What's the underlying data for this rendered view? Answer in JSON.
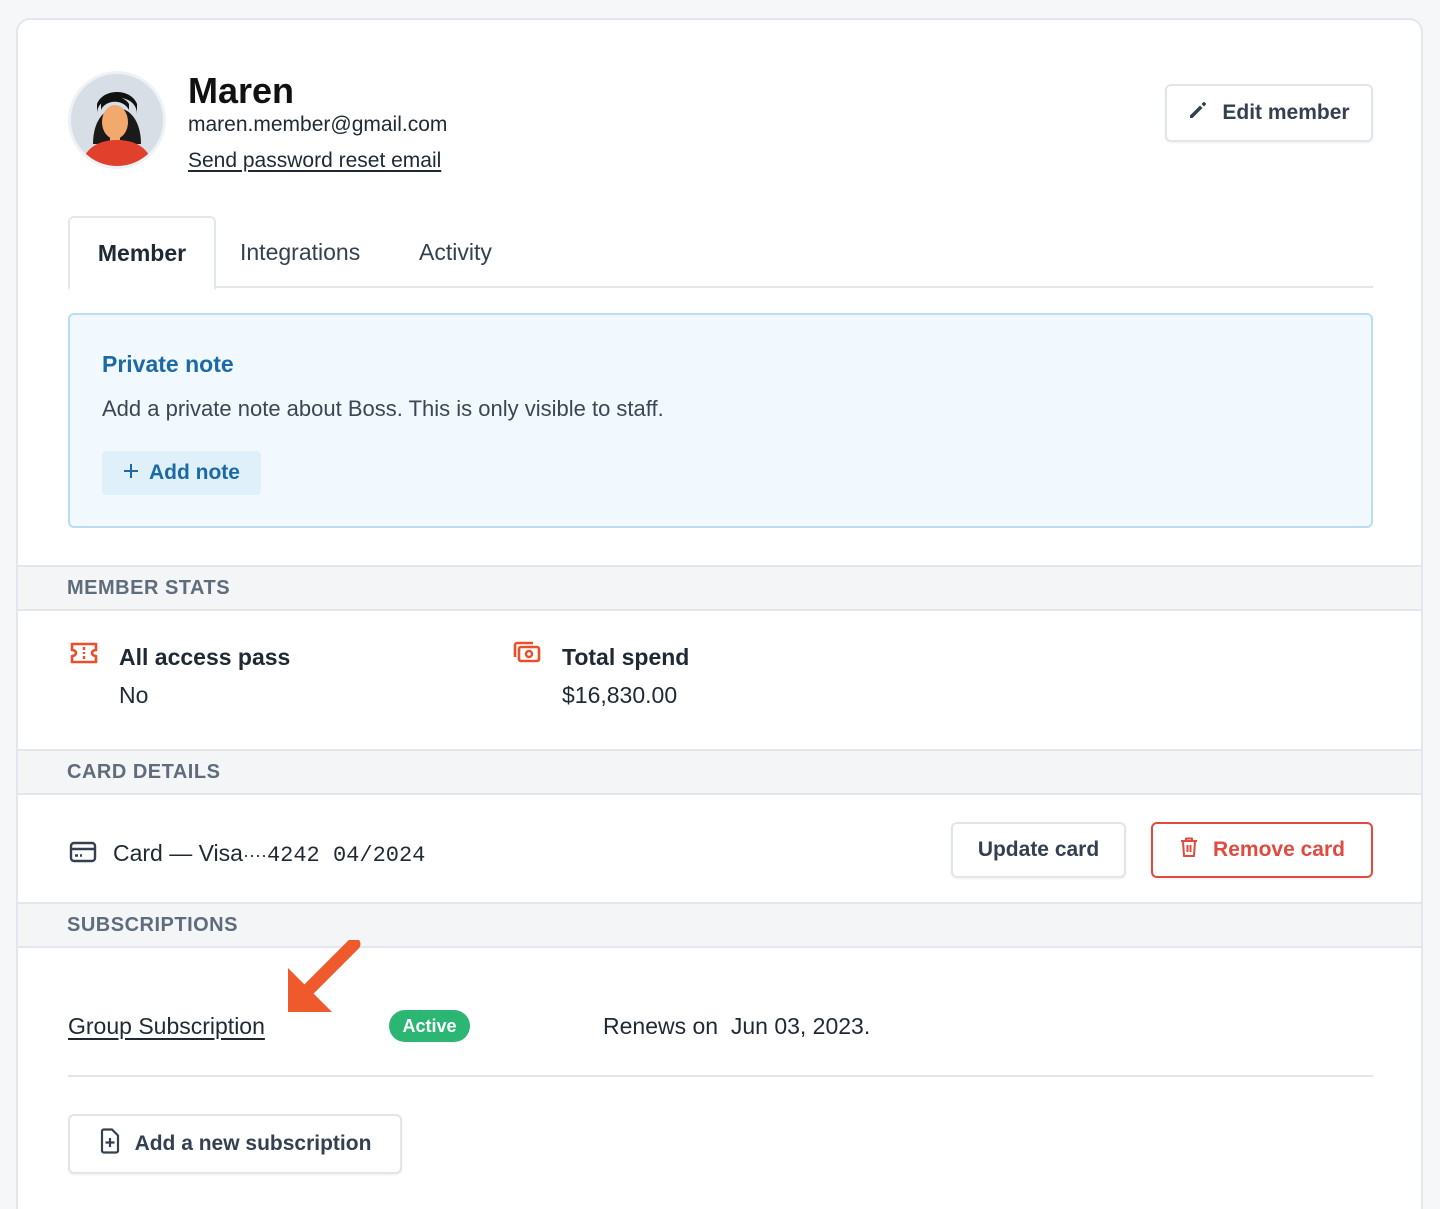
{
  "member": {
    "name": "Maren",
    "email": "maren.member@gmail.com",
    "reset_link": "Send password reset email",
    "edit_button": "Edit member"
  },
  "tabs": [
    {
      "label": "Member",
      "active": true
    },
    {
      "label": "Integrations",
      "active": false
    },
    {
      "label": "Activity",
      "active": false
    }
  ],
  "note": {
    "title": "Private note",
    "text": "Add a private note about Boss. This is only visible to staff.",
    "button": "Add note"
  },
  "stats": {
    "heading": "MEMBER STATS",
    "items": [
      {
        "label": "All access pass",
        "value": "No",
        "icon": "ticket-icon"
      },
      {
        "label": "Total spend",
        "value": "$16,830.00",
        "icon": "money-icon"
      }
    ]
  },
  "card_details": {
    "heading": "CARD DETAILS",
    "label": "Card — Visa ",
    "dots": "····",
    "number": "4242 04/2024",
    "update_button": "Update card",
    "remove_button": "Remove card"
  },
  "subscriptions": {
    "heading": "SUBSCRIPTIONS",
    "items": [
      {
        "name": "Group Subscription",
        "status": "Active",
        "renews_label": "Renews on  Jun 03, 2023."
      }
    ],
    "add_button": "Add a new subscription"
  },
  "colors": {
    "accent_blue": "#1b6aa5",
    "icon_orange": "#e8502c",
    "active_green": "#2bb673",
    "danger_red": "#e04a3f"
  }
}
